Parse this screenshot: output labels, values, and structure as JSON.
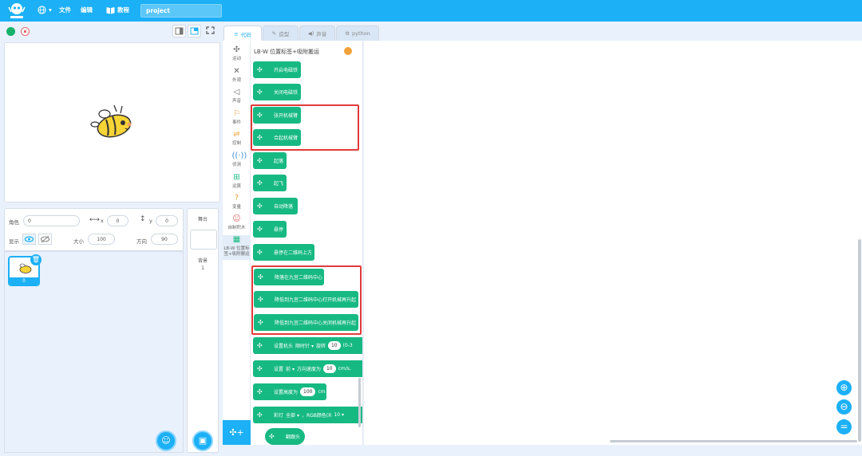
{
  "menu": {
    "globe_label": "",
    "file": "文件",
    "edit": "编辑",
    "tutorial": "教程",
    "project_name": "project"
  },
  "tabs": [
    {
      "label": "代码"
    },
    {
      "label": "造型"
    },
    {
      "label": "声音"
    },
    {
      "label": "python"
    }
  ],
  "sprite": {
    "name_label": "角色",
    "name": "0",
    "x_label": "x",
    "x": "0",
    "y_label": "y",
    "y": "0",
    "show_label": "显示",
    "size_label": "大小",
    "size": "100",
    "direction_label": "方向",
    "direction": "90",
    "thumb_num": "0"
  },
  "backdrop": {
    "title": "舞台",
    "label": "背景",
    "count": "1"
  },
  "categories": [
    {
      "label": "运动",
      "icon": "drone-icon"
    },
    {
      "label": "外观",
      "icon": "appearance-icon"
    },
    {
      "label": "声音",
      "icon": "sound-icon"
    },
    {
      "label": "事件",
      "icon": "flag-icon"
    },
    {
      "label": "控制",
      "icon": "control-icon"
    },
    {
      "label": "侦测",
      "icon": "sensing-icon"
    },
    {
      "label": "运算",
      "icon": "operator-icon"
    },
    {
      "label": "变量",
      "icon": "variable-icon"
    },
    {
      "label": "自制积木",
      "icon": "my-blocks-icon"
    },
    {
      "label": "LB-W 位置标签+吸附搬运",
      "icon": "lbw-icon"
    }
  ],
  "palette": {
    "title": "LB-W 位置标签+吸附搬运",
    "blocks": [
      {
        "label": "开启电磁铁"
      },
      {
        "label": "关闭电磁铁"
      },
      {
        "label": "张开机械臂"
      },
      {
        "label": "合起机械臂"
      },
      {
        "label": "起落"
      },
      {
        "label": "起飞"
      },
      {
        "label": "自动降落"
      },
      {
        "label": "悬停"
      },
      {
        "label": "悬停在二维码上方"
      },
      {
        "label": "降落在九宫二维码中心"
      },
      {
        "label": "降低到九宫二维码中心打开机械再升起"
      },
      {
        "label": "降低到九宫二维码中心关闭机械再升起"
      }
    ],
    "rotate_block": {
      "pre": "设置机头",
      "dir": "顺时针",
      "mid": "旋转",
      "val": "10",
      "post": "(0-3"
    },
    "speed_block": {
      "pre": "设置",
      "dir": "前",
      "mid": "方向速度为",
      "val": "10",
      "post": "cm/s,"
    },
    "height_block": {
      "pre": "设置高度为",
      "val": "100",
      "post": "cm"
    },
    "light_block": {
      "pre": "彩灯",
      "which": "全部",
      "mid": "，RGB颜色(R",
      "val": "10"
    },
    "jump_block": {
      "label": "翻跟头"
    }
  },
  "colors": {
    "topbar": "#1cb0f6",
    "block": "#17b982",
    "highlight": "#e23a3a",
    "tab_active_text": "#1cb0f6"
  }
}
